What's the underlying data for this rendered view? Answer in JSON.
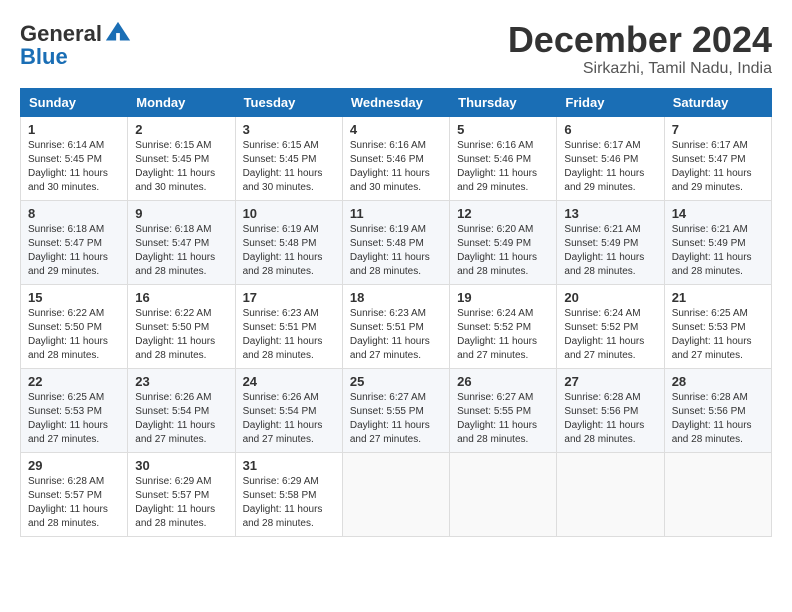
{
  "header": {
    "logo_general": "General",
    "logo_blue": "Blue",
    "month_title": "December 2024",
    "location": "Sirkazhi, Tamil Nadu, India"
  },
  "calendar": {
    "headers": [
      "Sunday",
      "Monday",
      "Tuesday",
      "Wednesday",
      "Thursday",
      "Friday",
      "Saturday"
    ],
    "weeks": [
      [
        {
          "day": "1",
          "sunrise": "6:14 AM",
          "sunset": "5:45 PM",
          "daylight": "11 hours and 30 minutes."
        },
        {
          "day": "2",
          "sunrise": "6:15 AM",
          "sunset": "5:45 PM",
          "daylight": "11 hours and 30 minutes."
        },
        {
          "day": "3",
          "sunrise": "6:15 AM",
          "sunset": "5:45 PM",
          "daylight": "11 hours and 30 minutes."
        },
        {
          "day": "4",
          "sunrise": "6:16 AM",
          "sunset": "5:46 PM",
          "daylight": "11 hours and 30 minutes."
        },
        {
          "day": "5",
          "sunrise": "6:16 AM",
          "sunset": "5:46 PM",
          "daylight": "11 hours and 29 minutes."
        },
        {
          "day": "6",
          "sunrise": "6:17 AM",
          "sunset": "5:46 PM",
          "daylight": "11 hours and 29 minutes."
        },
        {
          "day": "7",
          "sunrise": "6:17 AM",
          "sunset": "5:47 PM",
          "daylight": "11 hours and 29 minutes."
        }
      ],
      [
        {
          "day": "8",
          "sunrise": "6:18 AM",
          "sunset": "5:47 PM",
          "daylight": "11 hours and 29 minutes."
        },
        {
          "day": "9",
          "sunrise": "6:18 AM",
          "sunset": "5:47 PM",
          "daylight": "11 hours and 28 minutes."
        },
        {
          "day": "10",
          "sunrise": "6:19 AM",
          "sunset": "5:48 PM",
          "daylight": "11 hours and 28 minutes."
        },
        {
          "day": "11",
          "sunrise": "6:19 AM",
          "sunset": "5:48 PM",
          "daylight": "11 hours and 28 minutes."
        },
        {
          "day": "12",
          "sunrise": "6:20 AM",
          "sunset": "5:49 PM",
          "daylight": "11 hours and 28 minutes."
        },
        {
          "day": "13",
          "sunrise": "6:21 AM",
          "sunset": "5:49 PM",
          "daylight": "11 hours and 28 minutes."
        },
        {
          "day": "14",
          "sunrise": "6:21 AM",
          "sunset": "5:49 PM",
          "daylight": "11 hours and 28 minutes."
        }
      ],
      [
        {
          "day": "15",
          "sunrise": "6:22 AM",
          "sunset": "5:50 PM",
          "daylight": "11 hours and 28 minutes."
        },
        {
          "day": "16",
          "sunrise": "6:22 AM",
          "sunset": "5:50 PM",
          "daylight": "11 hours and 28 minutes."
        },
        {
          "day": "17",
          "sunrise": "6:23 AM",
          "sunset": "5:51 PM",
          "daylight": "11 hours and 28 minutes."
        },
        {
          "day": "18",
          "sunrise": "6:23 AM",
          "sunset": "5:51 PM",
          "daylight": "11 hours and 27 minutes."
        },
        {
          "day": "19",
          "sunrise": "6:24 AM",
          "sunset": "5:52 PM",
          "daylight": "11 hours and 27 minutes."
        },
        {
          "day": "20",
          "sunrise": "6:24 AM",
          "sunset": "5:52 PM",
          "daylight": "11 hours and 27 minutes."
        },
        {
          "day": "21",
          "sunrise": "6:25 AM",
          "sunset": "5:53 PM",
          "daylight": "11 hours and 27 minutes."
        }
      ],
      [
        {
          "day": "22",
          "sunrise": "6:25 AM",
          "sunset": "5:53 PM",
          "daylight": "11 hours and 27 minutes."
        },
        {
          "day": "23",
          "sunrise": "6:26 AM",
          "sunset": "5:54 PM",
          "daylight": "11 hours and 27 minutes."
        },
        {
          "day": "24",
          "sunrise": "6:26 AM",
          "sunset": "5:54 PM",
          "daylight": "11 hours and 27 minutes."
        },
        {
          "day": "25",
          "sunrise": "6:27 AM",
          "sunset": "5:55 PM",
          "daylight": "11 hours and 27 minutes."
        },
        {
          "day": "26",
          "sunrise": "6:27 AM",
          "sunset": "5:55 PM",
          "daylight": "11 hours and 28 minutes."
        },
        {
          "day": "27",
          "sunrise": "6:28 AM",
          "sunset": "5:56 PM",
          "daylight": "11 hours and 28 minutes."
        },
        {
          "day": "28",
          "sunrise": "6:28 AM",
          "sunset": "5:56 PM",
          "daylight": "11 hours and 28 minutes."
        }
      ],
      [
        {
          "day": "29",
          "sunrise": "6:28 AM",
          "sunset": "5:57 PM",
          "daylight": "11 hours and 28 minutes."
        },
        {
          "day": "30",
          "sunrise": "6:29 AM",
          "sunset": "5:57 PM",
          "daylight": "11 hours and 28 minutes."
        },
        {
          "day": "31",
          "sunrise": "6:29 AM",
          "sunset": "5:58 PM",
          "daylight": "11 hours and 28 minutes."
        },
        null,
        null,
        null,
        null
      ]
    ]
  }
}
